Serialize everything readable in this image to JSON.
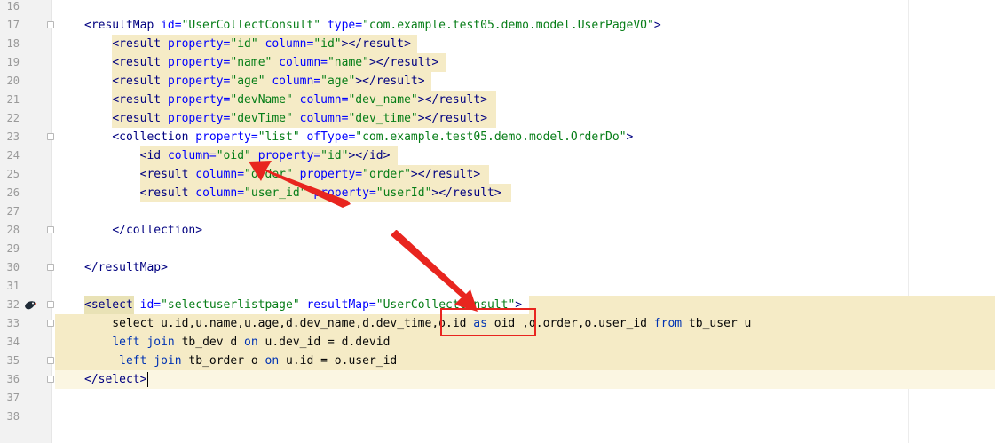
{
  "lines": [
    {
      "num": "16",
      "tokens": []
    },
    {
      "num": "17",
      "tokens": [
        [
          "tag",
          "<resultMap "
        ],
        [
          "attr",
          "id="
        ],
        [
          "val",
          "\"UserCollectConsult\""
        ],
        [
          "attr",
          " type="
        ],
        [
          "val",
          "\"com.example.test05.demo.model.UserPageVO\""
        ],
        [
          "tag",
          ">"
        ]
      ]
    },
    {
      "num": "18",
      "tokens": [
        [
          "txt",
          "    "
        ],
        [
          "tag",
          "<result "
        ],
        [
          "attr",
          "property="
        ],
        [
          "val",
          "\"id\""
        ],
        [
          "attr",
          " column="
        ],
        [
          "val",
          "\"id\""
        ],
        [
          "tag",
          "></result>"
        ]
      ]
    },
    {
      "num": "19",
      "tokens": [
        [
          "txt",
          "    "
        ],
        [
          "tag",
          "<result "
        ],
        [
          "attr",
          "property="
        ],
        [
          "val",
          "\"name\""
        ],
        [
          "attr",
          " column="
        ],
        [
          "val",
          "\"name\""
        ],
        [
          "tag",
          "></result>"
        ]
      ]
    },
    {
      "num": "20",
      "tokens": [
        [
          "txt",
          "    "
        ],
        [
          "tag",
          "<result "
        ],
        [
          "attr",
          "property="
        ],
        [
          "val",
          "\"age\""
        ],
        [
          "attr",
          " column="
        ],
        [
          "val",
          "\"age\""
        ],
        [
          "tag",
          "></result>"
        ]
      ]
    },
    {
      "num": "21",
      "tokens": [
        [
          "txt",
          "    "
        ],
        [
          "tag",
          "<result "
        ],
        [
          "attr",
          "property="
        ],
        [
          "val",
          "\"devName\""
        ],
        [
          "attr",
          " column="
        ],
        [
          "val",
          "\"dev_name\""
        ],
        [
          "tag",
          "></result>"
        ]
      ]
    },
    {
      "num": "22",
      "tokens": [
        [
          "txt",
          "    "
        ],
        [
          "tag",
          "<result "
        ],
        [
          "attr",
          "property="
        ],
        [
          "val",
          "\"devTime\""
        ],
        [
          "attr",
          " column="
        ],
        [
          "val",
          "\"dev_time\""
        ],
        [
          "tag",
          "></result>"
        ]
      ]
    },
    {
      "num": "23",
      "tokens": [
        [
          "txt",
          "    "
        ],
        [
          "tag",
          "<collection "
        ],
        [
          "attr",
          "property="
        ],
        [
          "val",
          "\"list\""
        ],
        [
          "attr",
          " ofType="
        ],
        [
          "val",
          "\"com.example.test05.demo.model.OrderDo\""
        ],
        [
          "tag",
          ">"
        ]
      ]
    },
    {
      "num": "24",
      "tokens": [
        [
          "txt",
          "        "
        ],
        [
          "tag",
          "<id "
        ],
        [
          "attr",
          "column="
        ],
        [
          "val",
          "\"oid\""
        ],
        [
          "attr",
          " property="
        ],
        [
          "val",
          "\"id\""
        ],
        [
          "tag",
          "></id>"
        ]
      ]
    },
    {
      "num": "25",
      "tokens": [
        [
          "txt",
          "        "
        ],
        [
          "tag",
          "<result "
        ],
        [
          "attr",
          "column="
        ],
        [
          "val",
          "\"order\""
        ],
        [
          "attr",
          " property="
        ],
        [
          "val",
          "\"order\""
        ],
        [
          "tag",
          "></result>"
        ]
      ]
    },
    {
      "num": "26",
      "tokens": [
        [
          "txt",
          "        "
        ],
        [
          "tag",
          "<result "
        ],
        [
          "attr",
          "column="
        ],
        [
          "val",
          "\"user_id\""
        ],
        [
          "attr",
          " property="
        ],
        [
          "val",
          "\"userId\""
        ],
        [
          "tag",
          "></result>"
        ]
      ]
    },
    {
      "num": "27",
      "tokens": []
    },
    {
      "num": "28",
      "tokens": [
        [
          "txt",
          "    "
        ],
        [
          "tag",
          "</collection>"
        ]
      ]
    },
    {
      "num": "29",
      "tokens": []
    },
    {
      "num": "30",
      "tokens": [
        [
          "tag",
          "</resultMap>"
        ]
      ]
    },
    {
      "num": "31",
      "tokens": []
    },
    {
      "num": "32",
      "tokens": [
        [
          "tag",
          "<select "
        ],
        [
          "attr",
          "id="
        ],
        [
          "val",
          "\"selectuserlistpage\""
        ],
        [
          "attr",
          " resultMap="
        ],
        [
          "val",
          "\"UserCollectConsult\""
        ],
        [
          "tag",
          ">"
        ]
      ]
    },
    {
      "num": "33",
      "tokens": [
        [
          "txt",
          "    select u.id,u.name,u.age,d.dev_name,d.dev_time,o.id "
        ],
        [
          "kw",
          "as"
        ],
        [
          "txt",
          " oid ,o.order,o.user_id "
        ],
        [
          "kw",
          "from"
        ],
        [
          "txt",
          " tb_user u"
        ]
      ]
    },
    {
      "num": "34",
      "tokens": [
        [
          "txt",
          "    "
        ],
        [
          "kw",
          "left join"
        ],
        [
          "txt",
          " tb_dev d "
        ],
        [
          "kw",
          "on"
        ],
        [
          "txt",
          " u.dev_id = d.devid"
        ]
      ]
    },
    {
      "num": "35",
      "tokens": [
        [
          "txt",
          "     "
        ],
        [
          "kw",
          "left join"
        ],
        [
          "txt",
          " tb_order o "
        ],
        [
          "kw",
          "on"
        ],
        [
          "txt",
          " u.id = o.user_id"
        ]
      ]
    },
    {
      "num": "36",
      "tokens": [
        [
          "tag",
          "</select>"
        ]
      ]
    },
    {
      "num": "37",
      "tokens": []
    },
    {
      "num": "38",
      "tokens": []
    }
  ],
  "colors": {
    "tag": "#000080",
    "attribute": "#0000ff",
    "value": "#067d17",
    "keyword": "#0033b3",
    "highlight": "#f5ebc6",
    "annotation": "#e8251f"
  },
  "icons": {
    "line_32": "mybatis-bird-icon"
  }
}
